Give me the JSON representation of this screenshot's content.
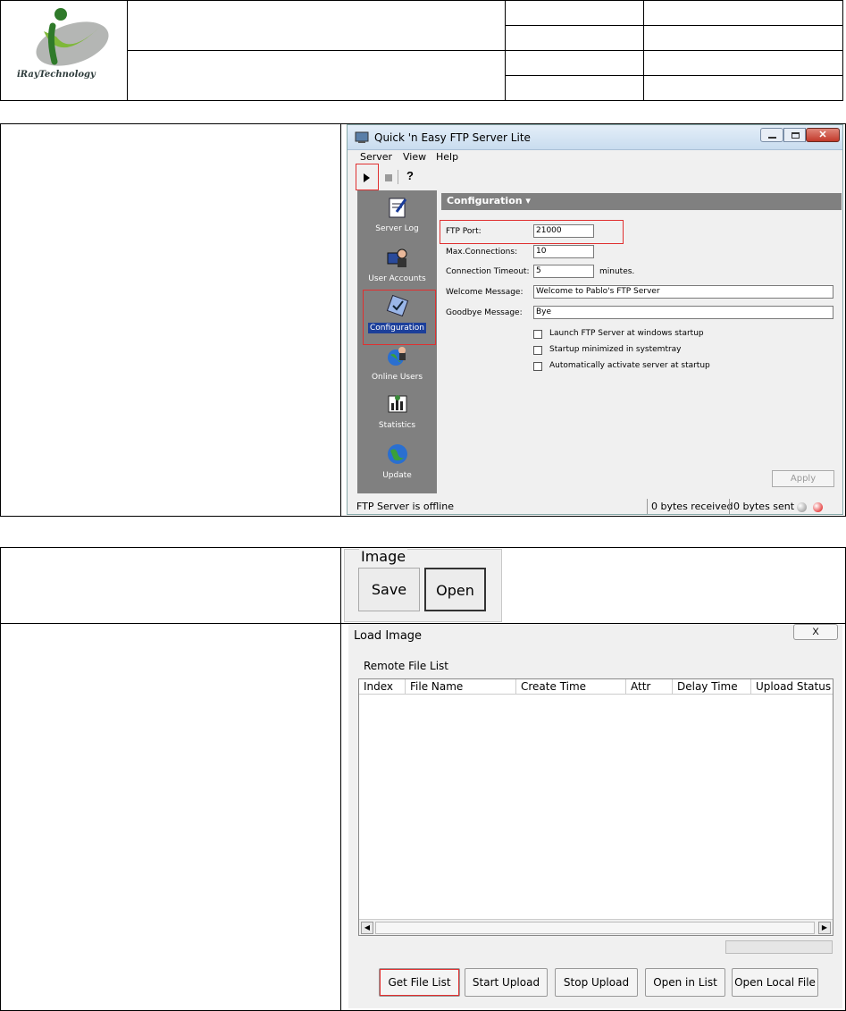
{
  "header": {
    "logo_text": "iRayTechnology"
  },
  "ftp_window": {
    "title": "Quick 'n Easy FTP Server Lite",
    "menu": [
      "Server",
      "View",
      "Help"
    ],
    "sidebar": [
      "Server Log",
      "User Accounts",
      "Configuration",
      "Online Users",
      "Statistics",
      "Update"
    ],
    "panel_title": "Configuration ▾",
    "fields": {
      "ftp_port_label": "FTP Port:",
      "ftp_port_value": "21000",
      "max_conn_label": "Max.Connections:",
      "max_conn_value": "10",
      "timeout_label": "Connection Timeout:",
      "timeout_value": "5",
      "timeout_unit": "minutes.",
      "welcome_label": "Welcome Message:",
      "welcome_value": "Welcome to Pablo's FTP Server",
      "goodbye_label": "Goodbye Message:",
      "goodbye_value": "Bye"
    },
    "checkboxes": [
      "Launch FTP Server at windows startup",
      "Startup minimized in systemtray",
      "Automatically activate server at startup"
    ],
    "apply_label": "Apply",
    "status": {
      "state": "FTP Server is offline",
      "received": "0 bytes received",
      "sent": "0 bytes sent"
    }
  },
  "image_group": {
    "legend": "Image",
    "save_label": "Save",
    "open_label": "Open"
  },
  "load_dialog": {
    "title": "Load Image",
    "close_label": "X",
    "list_label": "Remote File List",
    "columns": [
      "Index",
      "File Name",
      "Create Time",
      "Attr",
      "Delay Time",
      "Upload Status"
    ],
    "buttons": [
      "Get File List",
      "Start Upload",
      "Stop Upload",
      "Open in List",
      "Open Local File"
    ]
  }
}
